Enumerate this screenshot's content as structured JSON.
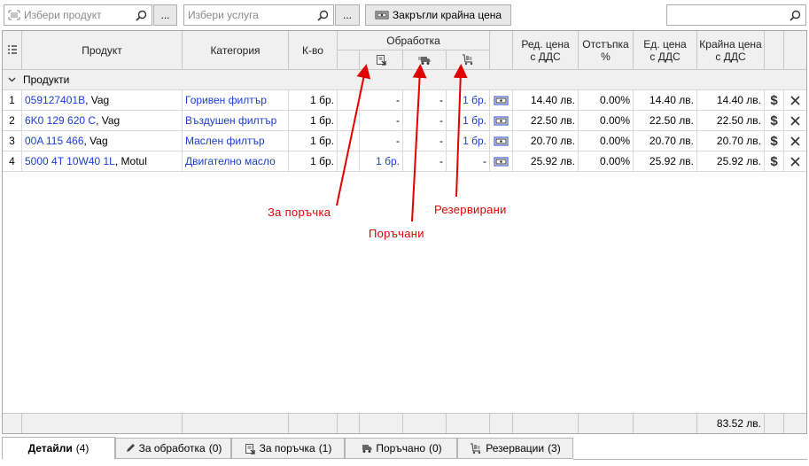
{
  "toolbar": {
    "product_placeholder": "Избери продукт",
    "product_more": "...",
    "service_placeholder": "Избери услуга",
    "service_more": "...",
    "round_button": "Закръгли крайна цена"
  },
  "grid": {
    "headers": {
      "product": "Продукт",
      "category": "Категория",
      "qty": "К-во",
      "processing": "Обработка",
      "unit_price_line1": "Ред. цена",
      "unit_price_line2": "с ДДС",
      "discount_line1": "Отстъпка",
      "discount_line2": "%",
      "net_price_line1": "Ед. цена",
      "net_price_line2": "с ДДС",
      "final_price_line1": "Крайна цена",
      "final_price_line2": "с ДДС"
    },
    "group_label": "Продукти",
    "rows": [
      {
        "num": "1",
        "code": "059127401B",
        "brand": ", Vag",
        "category": "Горивен филтър",
        "qty": "1 бр.",
        "to_order": "-",
        "ordered": "-",
        "reserved": "1 бр.",
        "unit_price": "14.40 лв.",
        "discount": "0.00%",
        "net_price": "14.40 лв.",
        "final_price": "14.40 лв."
      },
      {
        "num": "2",
        "code": "6K0 129 620 C",
        "brand": ", Vag",
        "category": "Въздушен филтър",
        "qty": "1 бр.",
        "to_order": "-",
        "ordered": "-",
        "reserved": "1 бр.",
        "unit_price": "22.50 лв.",
        "discount": "0.00%",
        "net_price": "22.50 лв.",
        "final_price": "22.50 лв."
      },
      {
        "num": "3",
        "code": "00A 115 466",
        "brand": ", Vag",
        "category": "Маслен филтър",
        "qty": "1 бр.",
        "to_order": "-",
        "ordered": "-",
        "reserved": "1 бр.",
        "unit_price": "20.70 лв.",
        "discount": "0.00%",
        "net_price": "20.70 лв.",
        "final_price": "20.70 лв."
      },
      {
        "num": "4",
        "code": "5000 4T 10W40 1L",
        "brand": ", Motul",
        "category": "Двигателно масло",
        "qty": "1 бр.",
        "to_order": "1 бр.",
        "ordered": "-",
        "reserved": "-",
        "unit_price": "25.92 лв.",
        "discount": "0.00%",
        "net_price": "25.92 лв.",
        "final_price": "25.92 лв."
      }
    ],
    "total": "83.52 лв."
  },
  "annotations": {
    "to_order": "За поръчка",
    "ordered": "Поръчани",
    "reserved": "Резервирани"
  },
  "tabs": [
    {
      "label": "Детайли",
      "count": "(4)"
    },
    {
      "label": "За обработка",
      "count": "(0)"
    },
    {
      "label": "За поръчка",
      "count": "(1)"
    },
    {
      "label": "Поръчано",
      "count": "(0)"
    },
    {
      "label": "Резервации",
      "count": "(3)"
    }
  ],
  "colors": {
    "link": "#1a3fd1",
    "annotation": "#e00000"
  }
}
